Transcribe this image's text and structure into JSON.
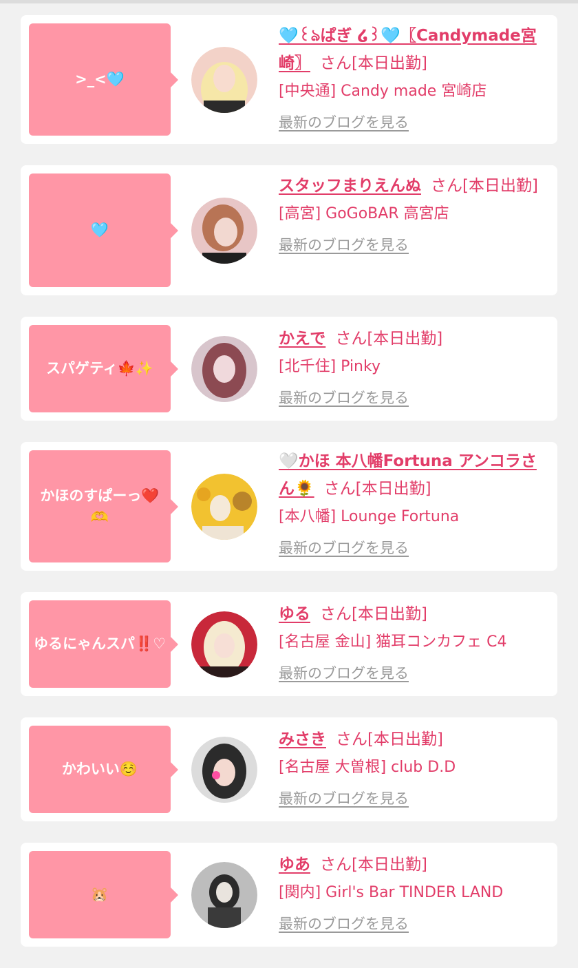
{
  "cards": [
    {
      "comment": ">_<🩵",
      "name": "🩵꒰ঌぱぎ ໒꒱🩵〖Candymade宮崎〗",
      "suffix": "さん[本日出勤]",
      "shop": "[中央通] Candy made 宮崎店",
      "blog_link": "最新のブログを見る",
      "avatar_colors": [
        "#f3d2c8",
        "#f6e7a8",
        "#d9a58c"
      ]
    },
    {
      "comment": "🩵",
      "name": "スタッフまりえんぬ",
      "suffix": "さん[本日出勤]",
      "shop": "[高宮] GoGoBAR 高宮店",
      "blog_link": "最新のブログを見る",
      "avatar_colors": [
        "#e8c6c6",
        "#b87455",
        "#f2d8d0"
      ]
    },
    {
      "comment": "スパゲティ🍁✨",
      "name": "かえで",
      "suffix": "さん[本日出勤]",
      "shop": "[北千住] Pinky",
      "blog_link": "最新のブログを見る",
      "avatar_colors": [
        "#d8c5cc",
        "#8c4a52",
        "#f0d9dc"
      ]
    },
    {
      "comment": "かほのすぱーっ❤️🫶",
      "name": "🤍かほ 本八幡Fortuna アンコラさん🌻",
      "suffix": "さん[本日出勤]",
      "shop": "[本八幡] Lounge Fortuna",
      "blog_link": "最新のブログを見る",
      "avatar_colors": [
        "#f2c230",
        "#f5e9d8",
        "#b9842a"
      ]
    },
    {
      "comment": "ゆるにゃんスパ‼️♡",
      "name": "ゆる",
      "suffix": "さん[本日出勤]",
      "shop": "[名古屋 金山] 猫耳コンカフェ C4",
      "blog_link": "最新のブログを見る",
      "avatar_colors": [
        "#c8283a",
        "#f5ead0",
        "#2a1a1a"
      ]
    },
    {
      "comment": "かわいい☺️",
      "name": "みさき",
      "suffix": "さん[本日出勤]",
      "shop": "[名古屋 大曽根] club D.D",
      "blog_link": "最新のブログを見る",
      "avatar_colors": [
        "#dcdcdc",
        "#2b2b2b",
        "#f4d9d0"
      ]
    },
    {
      "comment": "🐹",
      "name": "ゆあ",
      "suffix": "さん[本日出勤]",
      "shop": "[関内] Girl's Bar TINDER LAND",
      "blog_link": "最新のブログを見る",
      "avatar_colors": [
        "#bdbdbd",
        "#2b2b2b",
        "#e9e4de"
      ]
    }
  ]
}
